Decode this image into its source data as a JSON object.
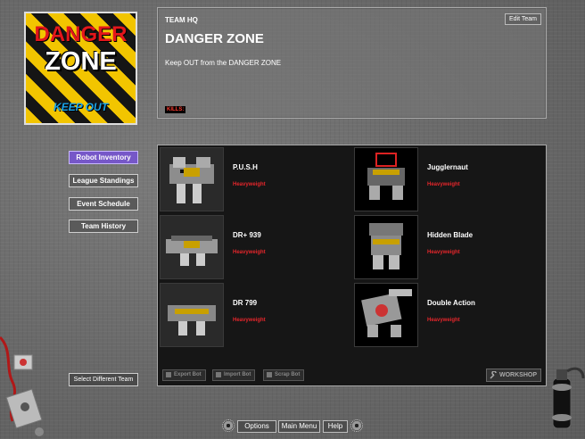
{
  "logo": {
    "line1": "DANGER",
    "line2": "ZONE",
    "line3": "KEEP OUT"
  },
  "hq": {
    "label": "TEAM HQ",
    "team_name": "DANGER ZONE",
    "motto": "Keep OUT from the DANGER ZONE",
    "kills_label": "KILLS:",
    "edit_label": "Edit Team"
  },
  "menu": {
    "items": [
      {
        "label": "Robot Inventory",
        "active": true
      },
      {
        "label": "League Standings",
        "active": false
      },
      {
        "label": "Event Schedule",
        "active": false
      },
      {
        "label": "Team History",
        "active": false
      }
    ],
    "select_team": "Select Different Team"
  },
  "robots": [
    {
      "name": "P.U.S.H",
      "weight_class": "Heavyweight"
    },
    {
      "name": "Jugglernaut",
      "weight_class": "Heavyweight"
    },
    {
      "name": "DR+ 939",
      "weight_class": "Heavyweight"
    },
    {
      "name": "Hidden Blade",
      "weight_class": "Heavyweight"
    },
    {
      "name": "DR 799",
      "weight_class": "Heavyweight"
    },
    {
      "name": "Double Action",
      "weight_class": "Heavyweight"
    }
  ],
  "inventory_actions": {
    "export": "Export Bot",
    "import": "Import Bot",
    "scrap": "Scrap Bot",
    "workshop": "WORKSHOP"
  },
  "bottom_bar": {
    "options": "Options",
    "main_menu": "Main Menu",
    "help": "Help"
  },
  "colors": {
    "accent_active": "#7657c8",
    "weight_class": "#e5262b",
    "logo_red": "#e3161b",
    "logo_blue": "#1aa3e8",
    "hazard_yellow": "#f2c500"
  }
}
